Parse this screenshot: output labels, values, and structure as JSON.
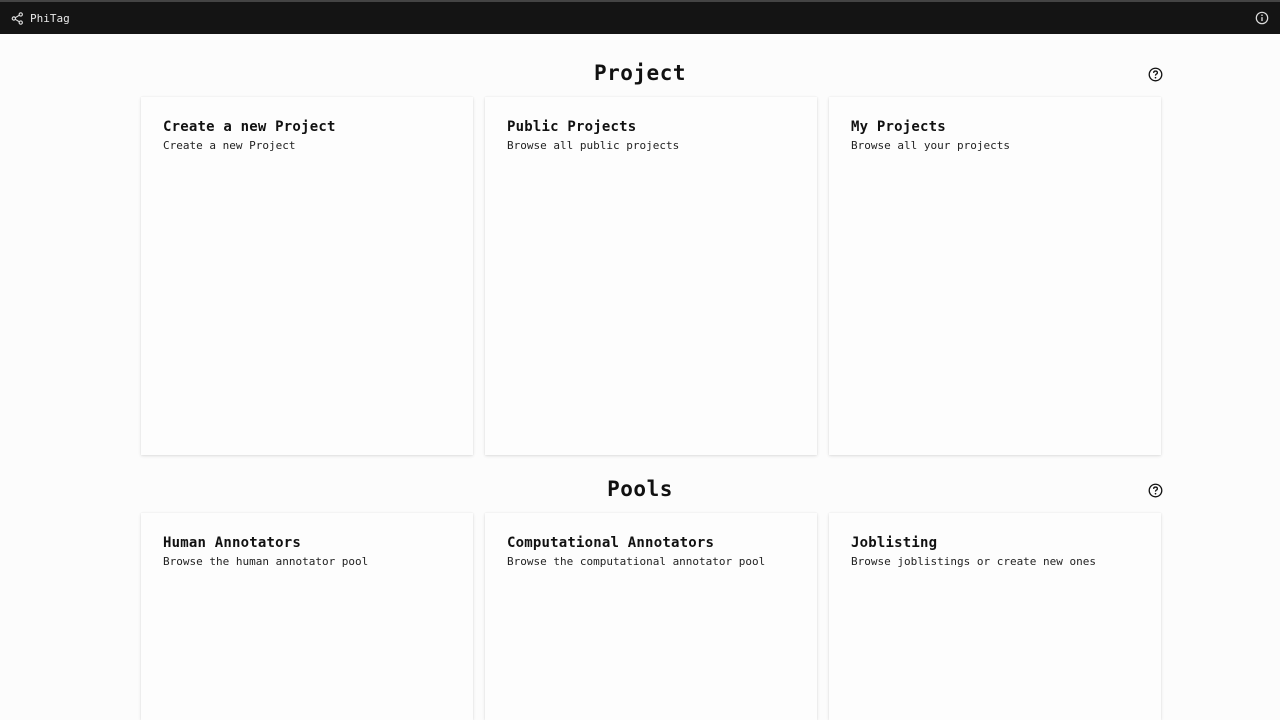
{
  "app": {
    "name": "PhiTag"
  },
  "sections": {
    "project": {
      "title": "Project",
      "cards": [
        {
          "title": "Create a new Project",
          "description": "Create a new Project"
        },
        {
          "title": "Public Projects",
          "description": "Browse all public projects"
        },
        {
          "title": "My Projects",
          "description": "Browse all your projects"
        }
      ]
    },
    "pools": {
      "title": "Pools",
      "cards": [
        {
          "title": "Human Annotators",
          "description": "Browse the human annotator pool"
        },
        {
          "title": "Computational Annotators",
          "description": "Browse the computational annotator pool"
        },
        {
          "title": "Joblisting",
          "description": "Browse joblistings or create new ones"
        }
      ]
    }
  },
  "icons": {
    "brand": "share-nodes-icon",
    "info": "info-circle-icon",
    "help": "question-circle-icon"
  }
}
